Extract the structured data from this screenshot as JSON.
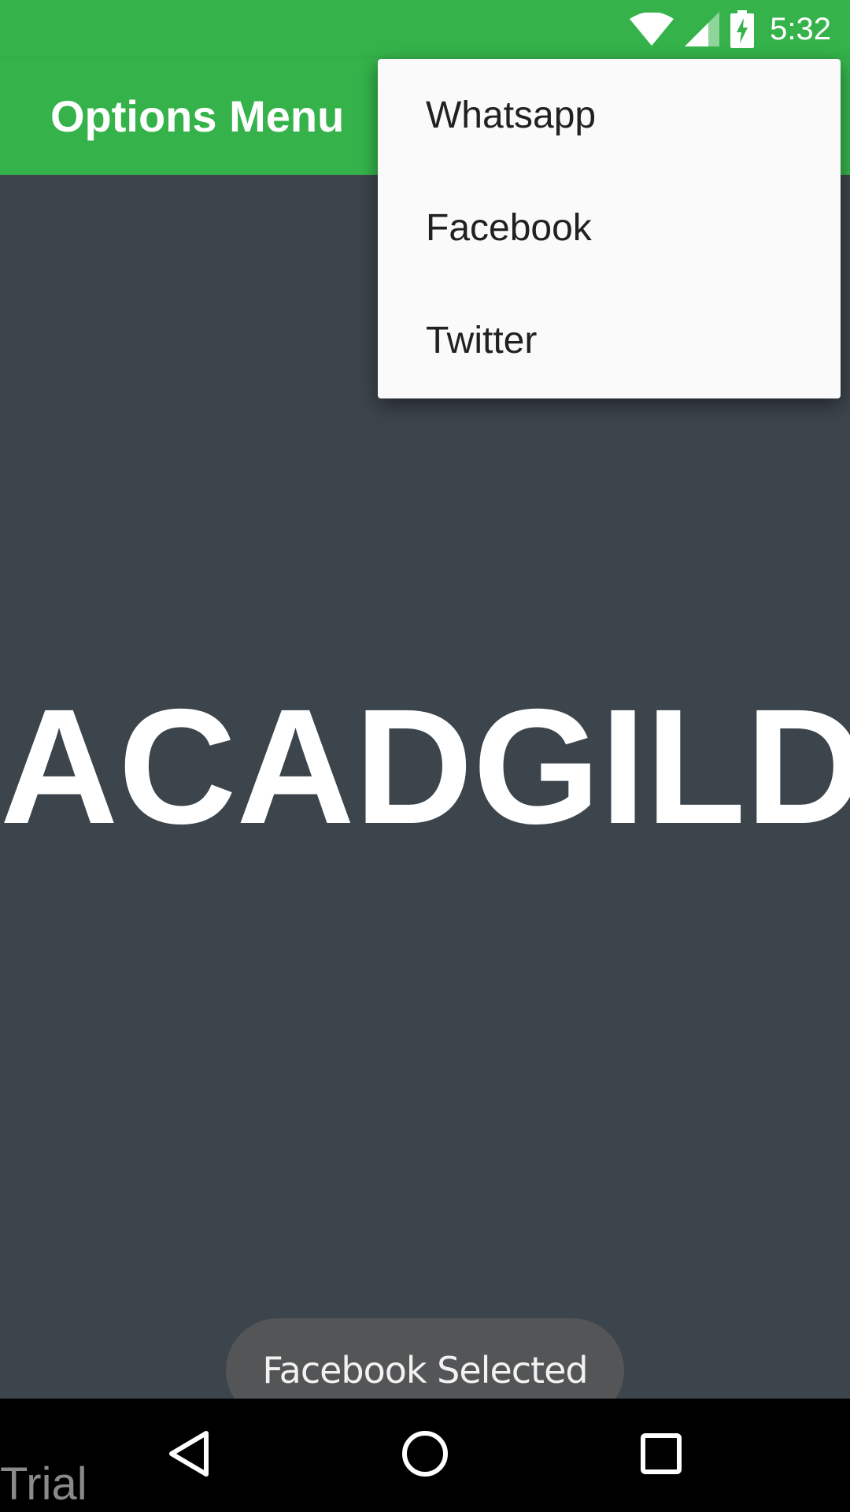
{
  "status_bar": {
    "time": "5:32",
    "icons": [
      "wifi-icon",
      "cell-signal-icon",
      "battery-charging-icon"
    ]
  },
  "app_bar": {
    "title": "Options Menu"
  },
  "main": {
    "hero_text": "ACADGILD"
  },
  "overflow_menu": {
    "items": [
      {
        "label": "Whatsapp"
      },
      {
        "label": "Facebook"
      },
      {
        "label": "Twitter"
      }
    ]
  },
  "toast": {
    "message": "Facebook Selected"
  },
  "nav_bar": {
    "buttons": [
      "back-icon",
      "home-icon",
      "recents-icon"
    ]
  },
  "watermark": {
    "text": "Trial"
  },
  "colors": {
    "app_bar": "#35b34a",
    "background": "#3c444c",
    "menu": "#fafafa",
    "toast": "#545556",
    "nav_bar": "#000000"
  }
}
